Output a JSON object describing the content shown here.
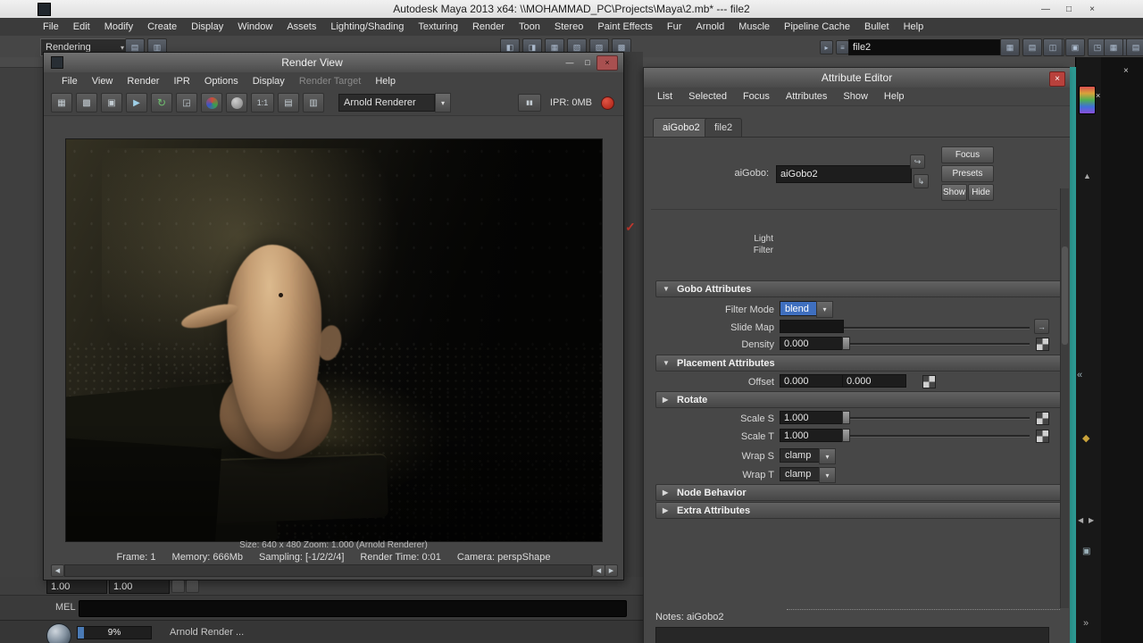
{
  "glyphs": {
    "minimize": "—",
    "maximize": "□",
    "close": "×",
    "dropdown": "▾",
    "open": "▼",
    "closed": "▶",
    "left": "◀",
    "right": "▶",
    "pause": "▮▮",
    "connect": "→",
    "check": "✓",
    "focus_in": "↪",
    "focus_out": "↳"
  },
  "titlebar": {
    "title": "Autodesk Maya 2013 x64: \\\\MOHAMMAD_PC\\Projects\\Maya\\2.mb*  ---  file2"
  },
  "menubar": {
    "items": [
      "File",
      "Edit",
      "Modify",
      "Create",
      "Display",
      "Window",
      "Assets",
      "Lighting/Shading",
      "Texturing",
      "Render",
      "Toon",
      "Stereo",
      "Paint Effects",
      "Fur",
      "Arnold",
      "Muscle",
      "Pipeline Cache",
      "Bullet",
      "Help"
    ]
  },
  "toolbar": {
    "menu_set": "Rendering",
    "scene_name": "file2",
    "group1": [
      "▤",
      "▥"
    ],
    "group2": [
      "◧",
      "◨",
      "▦",
      "▧",
      "▨",
      "▩"
    ],
    "group3": [
      "▸",
      "≡"
    ],
    "group4": [
      "▦",
      "▤",
      "▥"
    ],
    "group5": [
      "◫",
      "▣",
      "◳",
      "◱"
    ],
    "group6": [
      "▦",
      "▤"
    ]
  },
  "range_slider": {
    "start": "1.00",
    "end": "1.00"
  },
  "command_line": {
    "label": "MEL"
  },
  "status_bar": {
    "progress": "9%",
    "message": "Arnold Render ..."
  },
  "render_view": {
    "title": "Render View",
    "menu": [
      "File",
      "View",
      "Render",
      "IPR",
      "Options",
      "Display",
      "Render Target",
      "Help"
    ],
    "icons": {
      "render": "▦",
      "redo": "▩",
      "snapshot": "▣",
      "ipr": "▶",
      "refresh": "↻",
      "region": "◲",
      "one2one": "1:1",
      "keep": "▤",
      "remove": "▥"
    },
    "renderer": "Arnold Renderer",
    "ipr_memory": "IPR: 0MB",
    "size_line": "Size: 640 x 480  Zoom: 1.000    (Arnold Renderer)",
    "status": {
      "frame": "Frame: 1",
      "memory": "Memory: 666Mb",
      "sampling": "Sampling: [-1/2/2/4]",
      "time": "Render Time: 0:01",
      "camera": "Camera: perspShape"
    }
  },
  "attribute_editor": {
    "title": "Attribute Editor",
    "menu": [
      "List",
      "Selected",
      "Focus",
      "Attributes",
      "Show",
      "Help"
    ],
    "tabs": [
      "aiGobo2",
      "file2"
    ],
    "node_label": "aiGobo:",
    "node_name": "aiGobo2",
    "focus_button": "Focus",
    "presets_button": "Presets",
    "show_button": "Show",
    "hide_button": "Hide",
    "light_label": "Light",
    "filter_label": "Filter",
    "sections": {
      "gobo": "Gobo Attributes",
      "placement": "Placement Attributes",
      "rotate": "Rotate",
      "node_behavior": "Node Behavior",
      "extra": "Extra Attributes"
    },
    "rows": {
      "filter_mode_label": "Filter Mode",
      "filter_mode_value": "blend",
      "slide_map_label": "Slide Map",
      "density_label": "Density",
      "density_value": "0.000",
      "offset_label": "Offset",
      "offset_u": "0.000",
      "offset_v": "0.000",
      "scale_s_label": "Scale S",
      "scale_s_value": "1.000",
      "scale_t_label": "Scale T",
      "scale_t_value": "1.000",
      "wrap_s_label": "Wrap S",
      "wrap_s_value": "clamp",
      "wrap_t_label": "Wrap T",
      "wrap_t_value": "clamp"
    },
    "notes_label": "Notes: aiGobo2"
  },
  "right_panel": {
    "icons": {
      "close": "×",
      "up": "▲",
      "collapse": "«",
      "bucket": "◆",
      "left": "◀",
      "right": "▶",
      "panel": "▣",
      "expand": "»"
    }
  }
}
